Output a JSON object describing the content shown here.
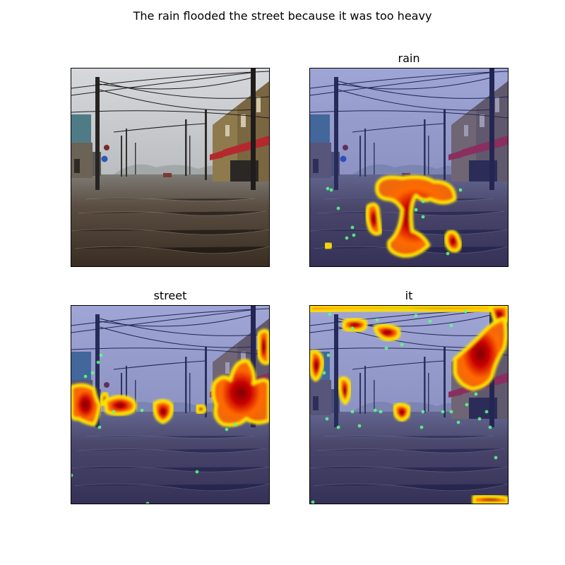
{
  "figure": {
    "title": "The rain flooded the street because it was too heavy",
    "panels": [
      {
        "title": "",
        "overlay": false,
        "heat": []
      },
      {
        "title": "rain",
        "overlay": true,
        "heat": "rain"
      },
      {
        "title": "street",
        "overlay": true,
        "heat": "street"
      },
      {
        "title": "it",
        "overlay": true,
        "heat": "it"
      }
    ]
  },
  "colors": {
    "sky": "#c9ccd1",
    "water": "#4a3c30",
    "overlay_blue": "#2b3cc8",
    "heat_hot": "#cc0000",
    "heat_warm": "#ff6a00",
    "heat_edge": "#ffe400",
    "heat_outer": "#5cff8a"
  }
}
